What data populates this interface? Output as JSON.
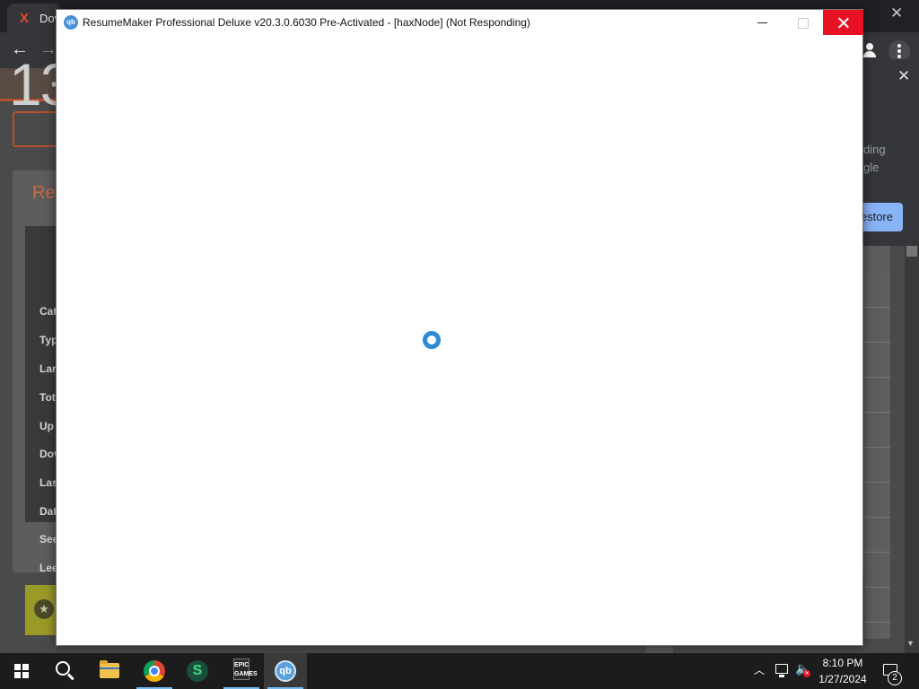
{
  "browser": {
    "tab_title": "Dov",
    "tab_favicon": "X"
  },
  "page": {
    "big_number": "13",
    "panel_title": "Res",
    "info_labels": [
      "Cat",
      "Typ",
      "Lar",
      "Tot",
      "Up",
      "Dov",
      "Las",
      "Dat",
      "See",
      "Lee"
    ]
  },
  "popup": {
    "text_lines": [
      "ding",
      "gle"
    ],
    "button_label": "estore"
  },
  "window": {
    "app_icon_label": "qb",
    "title": "ResumeMaker Professional Deluxe v20.3.0.6030 Pre-Activated - [haxNode] (Not Responding)"
  },
  "taskbar": {
    "epic_label": "EPIC\nGAMES",
    "qb_label": "qb",
    "time": "8:10 PM",
    "date": "1/27/2024",
    "notification_count": "2"
  },
  "colors": {
    "accent": "#b7502c",
    "close_red": "#e81123",
    "spinner_blue": "#2f8ad6",
    "taskbar_bg": "#1c1c1c"
  }
}
